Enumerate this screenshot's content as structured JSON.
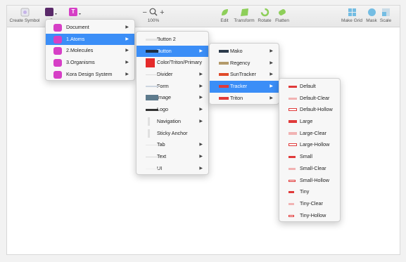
{
  "toolbar": {
    "create_symbol": "Create Symbol",
    "s_label": "S",
    "zoom_value": "100%",
    "zoom_minus": "−",
    "zoom_plus": "+",
    "edit": "Edit",
    "transform": "Transform",
    "rotate": "Rotate",
    "flatten": "Flatten",
    "make_grid": "Make Grid",
    "mask": "Mask",
    "scale": "Scale",
    "text_tool_glyph": "T"
  },
  "menu1": {
    "items": [
      "Document",
      "1.Atoms",
      "2.Molecules",
      "3.Organisms",
      "Kora Design System"
    ]
  },
  "menu2": {
    "items": [
      "Button 2",
      "Button",
      "Color/Triton/Primary",
      "Divider",
      "Form",
      "Image",
      "Logo",
      "Navigation",
      "Sticky Anchor",
      "Tab",
      "Text",
      "UI"
    ]
  },
  "menu3": {
    "items": [
      "Mako",
      "Regency",
      "SunTracker",
      "Tracker",
      "Triton"
    ]
  },
  "menu4": {
    "items": [
      "Default",
      "Default-Clear",
      "Default-Hollow",
      "Large",
      "Large-Clear",
      "Large-Hollow",
      "Small",
      "Small-Clear",
      "Small-Hollow",
      "Tiny",
      "Tiny-Clear",
      "Tiny-Hollow"
    ]
  },
  "colors": {
    "accent": "#3b8ef7",
    "symbol_icon": "#d63fc6",
    "tracker_red": "#e03a3a",
    "toolbar_green": "#8ecf5a",
    "toolbar_blue": "#74bde3"
  }
}
